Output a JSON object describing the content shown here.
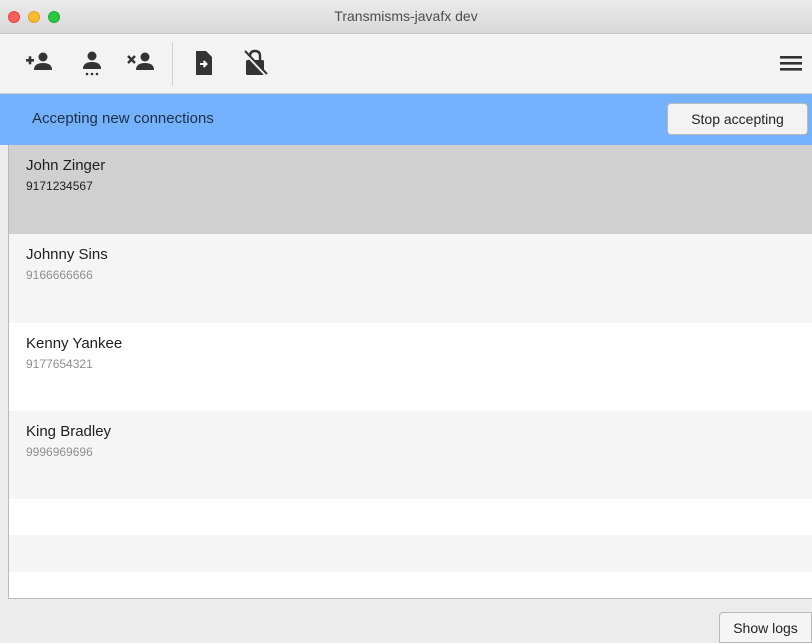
{
  "window": {
    "title": "Transmisms-javafx dev"
  },
  "toolbar": {
    "icons": [
      "add-contact-icon",
      "contact-more-icon",
      "remove-contact-icon",
      "import-file-icon",
      "lock-off-icon",
      "menu-icon"
    ]
  },
  "banner": {
    "text": "Accepting new connections",
    "button_label": "Stop accepting",
    "color": "#74b2fe"
  },
  "contacts": [
    {
      "name": "John Zinger",
      "phone": "9171234567",
      "selected": true
    },
    {
      "name": "Johnny Sins",
      "phone": "9166666666",
      "selected": false
    },
    {
      "name": "Kenny Yankee",
      "phone": "9177654321",
      "selected": false
    },
    {
      "name": "King Bradley",
      "phone": "9996969696",
      "selected": false
    }
  ],
  "footer": {
    "show_logs_label": "Show logs"
  }
}
